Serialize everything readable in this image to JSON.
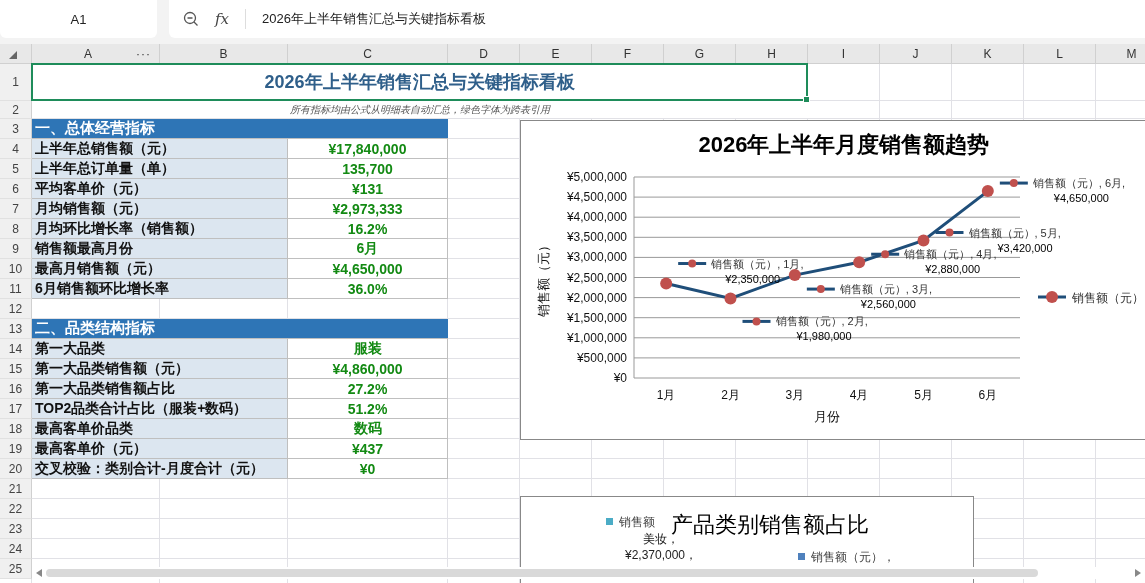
{
  "formula_bar": {
    "cell_ref": "A1",
    "function_label": "fx",
    "formula": "2026年上半年销售汇总与关键指标看板"
  },
  "columns": [
    "A",
    "B",
    "C",
    "D",
    "E",
    "F",
    "G",
    "H",
    "I",
    "J",
    "K",
    "L",
    "M"
  ],
  "column_menu": "···",
  "row_numbers": [
    "1",
    "2",
    "3",
    "4",
    "5",
    "6",
    "7",
    "8",
    "9",
    "10",
    "11",
    "12",
    "13",
    "14",
    "15",
    "16",
    "17",
    "18",
    "19",
    "20",
    "21",
    "22",
    "23",
    "24",
    "25"
  ],
  "title": "2026年上半年销售汇总与关键指标看板",
  "note": "所有指标均由公式从明细表自动汇总，绿色字体为跨表引用",
  "sections": [
    {
      "header": "一、总体经营指标",
      "items": [
        {
          "label": "上半年总销售额（元）",
          "value": "¥17,840,000"
        },
        {
          "label": "上半年总订单量（单）",
          "value": "135,700"
        },
        {
          "label": "平均客单价（元）",
          "value": "¥131"
        },
        {
          "label": "月均销售额（元）",
          "value": "¥2,973,333"
        },
        {
          "label": "月均环比增长率（销售额）",
          "value": "16.2%"
        },
        {
          "label": "销售额最高月份",
          "value": "6月"
        },
        {
          "label": "最高月销售额（元）",
          "value": "¥4,650,000"
        },
        {
          "label": "6月销售额环比增长率",
          "value": "36.0%"
        }
      ]
    },
    {
      "header": "二、品类结构指标",
      "items": [
        {
          "label": "第一大品类",
          "value": "服装"
        },
        {
          "label": "第一大品类销售额（元）",
          "value": "¥4,860,000"
        },
        {
          "label": "第一大品类销售额占比",
          "value": "27.2%"
        },
        {
          "label": "TOP2品类合计占比（服装+数码）",
          "value": "51.2%"
        },
        {
          "label": "最高客单价品类",
          "value": "数码"
        },
        {
          "label": "最高客单价（元）",
          "value": "¥437"
        },
        {
          "label": "交叉校验：类别合计-月度合计（元）",
          "value": "¥0"
        }
      ]
    }
  ],
  "trend_chart": {
    "chart_data": {
      "type": "line",
      "grid": true,
      "title": "2026年上半年月度销售额趋势",
      "xlabel": "月份",
      "ylabel": "销售额（元）",
      "categories": [
        "1月",
        "2月",
        "3月",
        "4月",
        "5月",
        "6月"
      ],
      "series": [
        {
          "name": "销售额（元）",
          "color": "#1f4e79",
          "marker": "circle",
          "values": [
            2350000,
            1980000,
            2560000,
            2880000,
            3420000,
            4650000
          ]
        }
      ],
      "ylim": [
        0,
        5000000
      ],
      "yticks": [
        {
          "value": 0,
          "label": "¥0"
        },
        {
          "value": 500000,
          "label": "¥500,000"
        },
        {
          "value": 1000000,
          "label": "¥1,000,000"
        },
        {
          "value": 1500000,
          "label": "¥1,500,000"
        },
        {
          "value": 2000000,
          "label": "¥2,000,000"
        },
        {
          "value": 2500000,
          "label": "¥2,500,000"
        },
        {
          "value": 3000000,
          "label": "¥3,000,000"
        },
        {
          "value": 3500000,
          "label": "¥3,500,000"
        },
        {
          "value": 4000000,
          "label": "¥4,000,000"
        },
        {
          "value": 4500000,
          "label": "¥4,500,000"
        },
        {
          "value": 5000000,
          "label": "¥5,000,000"
        }
      ],
      "value_labels": [
        [
          "销售额（元）, 1月,",
          "¥2,350,000"
        ],
        [
          "销售额（元）, 2月,",
          "¥1,980,000"
        ],
        [
          "销售额（元）, 3月,",
          "¥2,560,000"
        ],
        [
          "销售额（元）, 4月,",
          "¥2,880,000"
        ],
        [
          "销售额（元）, 5月,",
          "¥3,420,000"
        ],
        [
          "销售额（元）, 6月,",
          "¥4,650,000"
        ]
      ]
    }
  },
  "category_chart": {
    "title": "产品类别销售额占比",
    "legend_items": [
      {
        "text": "销售额",
        "color": "#4bacc6"
      },
      {
        "text": "销售额（元），",
        "color": "#4f81bd"
      }
    ],
    "slice_label": [
      "美妆，",
      "¥2,370,000，"
    ]
  }
}
